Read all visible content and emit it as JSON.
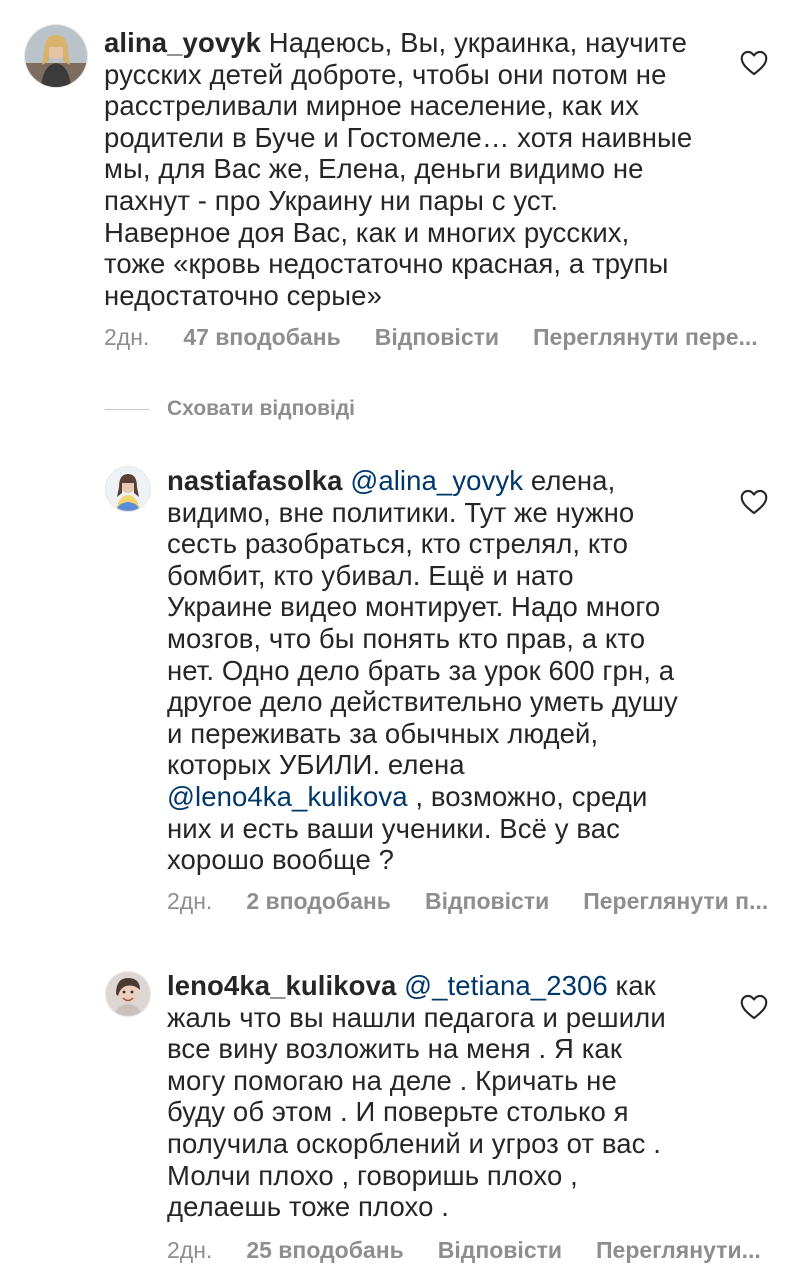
{
  "comments": [
    {
      "username": "alina_yovyk",
      "text": " Надеюсь, Вы, украинка, научите\nрусских детей доброте, чтобы они потом не\nрасстреливали  мирное население, как их\nродители в Буче и Гостомеле… хотя наивные\nмы, для Вас же, Елена, деньги видимо не\nпахнут - про Украину ни пары с уст.\nНаверное доя Вас, как и многих русских,\nтоже «кровь недостаточно красная, а трупы\nнедостаточно серые»",
      "time": "2дн.",
      "likes": "47 вподобань",
      "reply": "Відповісти",
      "see_translation": "Переглянути пере..."
    },
    {
      "username": "nastiafasolka",
      "mention": "@alina_yovyk",
      "text_before_mention2": " елена,\nвидимо, вне политики. Тут же нужно\nсесть разобраться, кто стрелял, кто\nбомбит, кто убивал. Ещё и нато\nУкраине видео монтирует. Надо много\nмозгов, что бы понять кто прав, а кто\nнет. Одно дело брать за урок 600 грн, а\nдругое дело действительно уметь душу\nи переживать за обычных людей,\nкоторых УБИЛИ. елена\n",
      "mention2": "@leno4ka_kulikova",
      "text_after_mention2": " , возможно, среди\nних и есть ваши ученики. Всё у вас\nхорошо вообще ?",
      "time": "2дн.",
      "likes": "2 вподобань",
      "reply": "Відповісти",
      "see_translation": "Переглянути п..."
    },
    {
      "username": "leno4ka_kulikova",
      "mention": "@_tetiana_2306",
      "text": " как\nжаль что вы нашли педагога и решили\nвсе вину возложить на меня . Я как\nмогу помогаю на деле . Кричать не\nбуду об этом . И поверьте столько я\nполучила оскорблений и угроз от вас .\nМолчи плохо , говоришь плохо ,\nделаешь тоже плохо .",
      "time": "2дн.",
      "likes": "25 вподобань",
      "reply": "Відповісти",
      "see_translation": "Переглянути..."
    }
  ],
  "hide_replies_label": "Сховати відповіді",
  "colors": {
    "text": "#262626",
    "secondary": "#8e8e8e",
    "mention": "#00376b",
    "background": "#ffffff"
  },
  "icons": {
    "like": "heart-outline-icon"
  }
}
